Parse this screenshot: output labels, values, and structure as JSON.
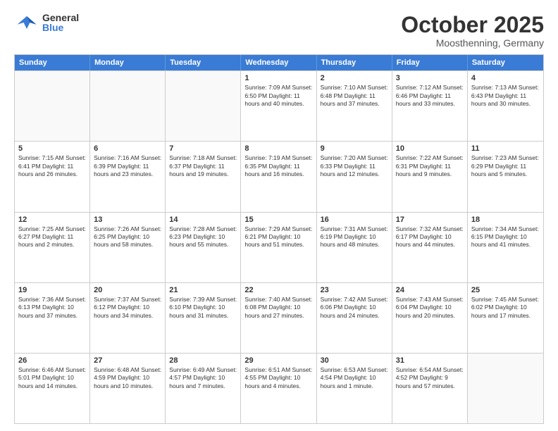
{
  "header": {
    "logo": {
      "general": "General",
      "blue": "Blue"
    },
    "title": "October 2025",
    "location": "Moosthenning, Germany"
  },
  "days_of_week": [
    "Sunday",
    "Monday",
    "Tuesday",
    "Wednesday",
    "Thursday",
    "Friday",
    "Saturday"
  ],
  "weeks": [
    [
      {
        "day": "",
        "info": "",
        "empty": true
      },
      {
        "day": "",
        "info": "",
        "empty": true
      },
      {
        "day": "",
        "info": "",
        "empty": true
      },
      {
        "day": "1",
        "info": "Sunrise: 7:09 AM\nSunset: 6:50 PM\nDaylight: 11 hours\nand 40 minutes."
      },
      {
        "day": "2",
        "info": "Sunrise: 7:10 AM\nSunset: 6:48 PM\nDaylight: 11 hours\nand 37 minutes."
      },
      {
        "day": "3",
        "info": "Sunrise: 7:12 AM\nSunset: 6:46 PM\nDaylight: 11 hours\nand 33 minutes."
      },
      {
        "day": "4",
        "info": "Sunrise: 7:13 AM\nSunset: 6:43 PM\nDaylight: 11 hours\nand 30 minutes."
      }
    ],
    [
      {
        "day": "5",
        "info": "Sunrise: 7:15 AM\nSunset: 6:41 PM\nDaylight: 11 hours\nand 26 minutes."
      },
      {
        "day": "6",
        "info": "Sunrise: 7:16 AM\nSunset: 6:39 PM\nDaylight: 11 hours\nand 23 minutes."
      },
      {
        "day": "7",
        "info": "Sunrise: 7:18 AM\nSunset: 6:37 PM\nDaylight: 11 hours\nand 19 minutes."
      },
      {
        "day": "8",
        "info": "Sunrise: 7:19 AM\nSunset: 6:35 PM\nDaylight: 11 hours\nand 16 minutes."
      },
      {
        "day": "9",
        "info": "Sunrise: 7:20 AM\nSunset: 6:33 PM\nDaylight: 11 hours\nand 12 minutes."
      },
      {
        "day": "10",
        "info": "Sunrise: 7:22 AM\nSunset: 6:31 PM\nDaylight: 11 hours\nand 9 minutes."
      },
      {
        "day": "11",
        "info": "Sunrise: 7:23 AM\nSunset: 6:29 PM\nDaylight: 11 hours\nand 5 minutes."
      }
    ],
    [
      {
        "day": "12",
        "info": "Sunrise: 7:25 AM\nSunset: 6:27 PM\nDaylight: 11 hours\nand 2 minutes."
      },
      {
        "day": "13",
        "info": "Sunrise: 7:26 AM\nSunset: 6:25 PM\nDaylight: 10 hours\nand 58 minutes."
      },
      {
        "day": "14",
        "info": "Sunrise: 7:28 AM\nSunset: 6:23 PM\nDaylight: 10 hours\nand 55 minutes."
      },
      {
        "day": "15",
        "info": "Sunrise: 7:29 AM\nSunset: 6:21 PM\nDaylight: 10 hours\nand 51 minutes."
      },
      {
        "day": "16",
        "info": "Sunrise: 7:31 AM\nSunset: 6:19 PM\nDaylight: 10 hours\nand 48 minutes."
      },
      {
        "day": "17",
        "info": "Sunrise: 7:32 AM\nSunset: 6:17 PM\nDaylight: 10 hours\nand 44 minutes."
      },
      {
        "day": "18",
        "info": "Sunrise: 7:34 AM\nSunset: 6:15 PM\nDaylight: 10 hours\nand 41 minutes."
      }
    ],
    [
      {
        "day": "19",
        "info": "Sunrise: 7:36 AM\nSunset: 6:13 PM\nDaylight: 10 hours\nand 37 minutes."
      },
      {
        "day": "20",
        "info": "Sunrise: 7:37 AM\nSunset: 6:12 PM\nDaylight: 10 hours\nand 34 minutes."
      },
      {
        "day": "21",
        "info": "Sunrise: 7:39 AM\nSunset: 6:10 PM\nDaylight: 10 hours\nand 31 minutes."
      },
      {
        "day": "22",
        "info": "Sunrise: 7:40 AM\nSunset: 6:08 PM\nDaylight: 10 hours\nand 27 minutes."
      },
      {
        "day": "23",
        "info": "Sunrise: 7:42 AM\nSunset: 6:06 PM\nDaylight: 10 hours\nand 24 minutes."
      },
      {
        "day": "24",
        "info": "Sunrise: 7:43 AM\nSunset: 6:04 PM\nDaylight: 10 hours\nand 20 minutes."
      },
      {
        "day": "25",
        "info": "Sunrise: 7:45 AM\nSunset: 6:02 PM\nDaylight: 10 hours\nand 17 minutes."
      }
    ],
    [
      {
        "day": "26",
        "info": "Sunrise: 6:46 AM\nSunset: 5:01 PM\nDaylight: 10 hours\nand 14 minutes."
      },
      {
        "day": "27",
        "info": "Sunrise: 6:48 AM\nSunset: 4:59 PM\nDaylight: 10 hours\nand 10 minutes."
      },
      {
        "day": "28",
        "info": "Sunrise: 6:49 AM\nSunset: 4:57 PM\nDaylight: 10 hours\nand 7 minutes."
      },
      {
        "day": "29",
        "info": "Sunrise: 6:51 AM\nSunset: 4:55 PM\nDaylight: 10 hours\nand 4 minutes."
      },
      {
        "day": "30",
        "info": "Sunrise: 6:53 AM\nSunset: 4:54 PM\nDaylight: 10 hours\nand 1 minute."
      },
      {
        "day": "31",
        "info": "Sunrise: 6:54 AM\nSunset: 4:52 PM\nDaylight: 9 hours\nand 57 minutes."
      },
      {
        "day": "",
        "info": "",
        "empty": true
      }
    ]
  ]
}
